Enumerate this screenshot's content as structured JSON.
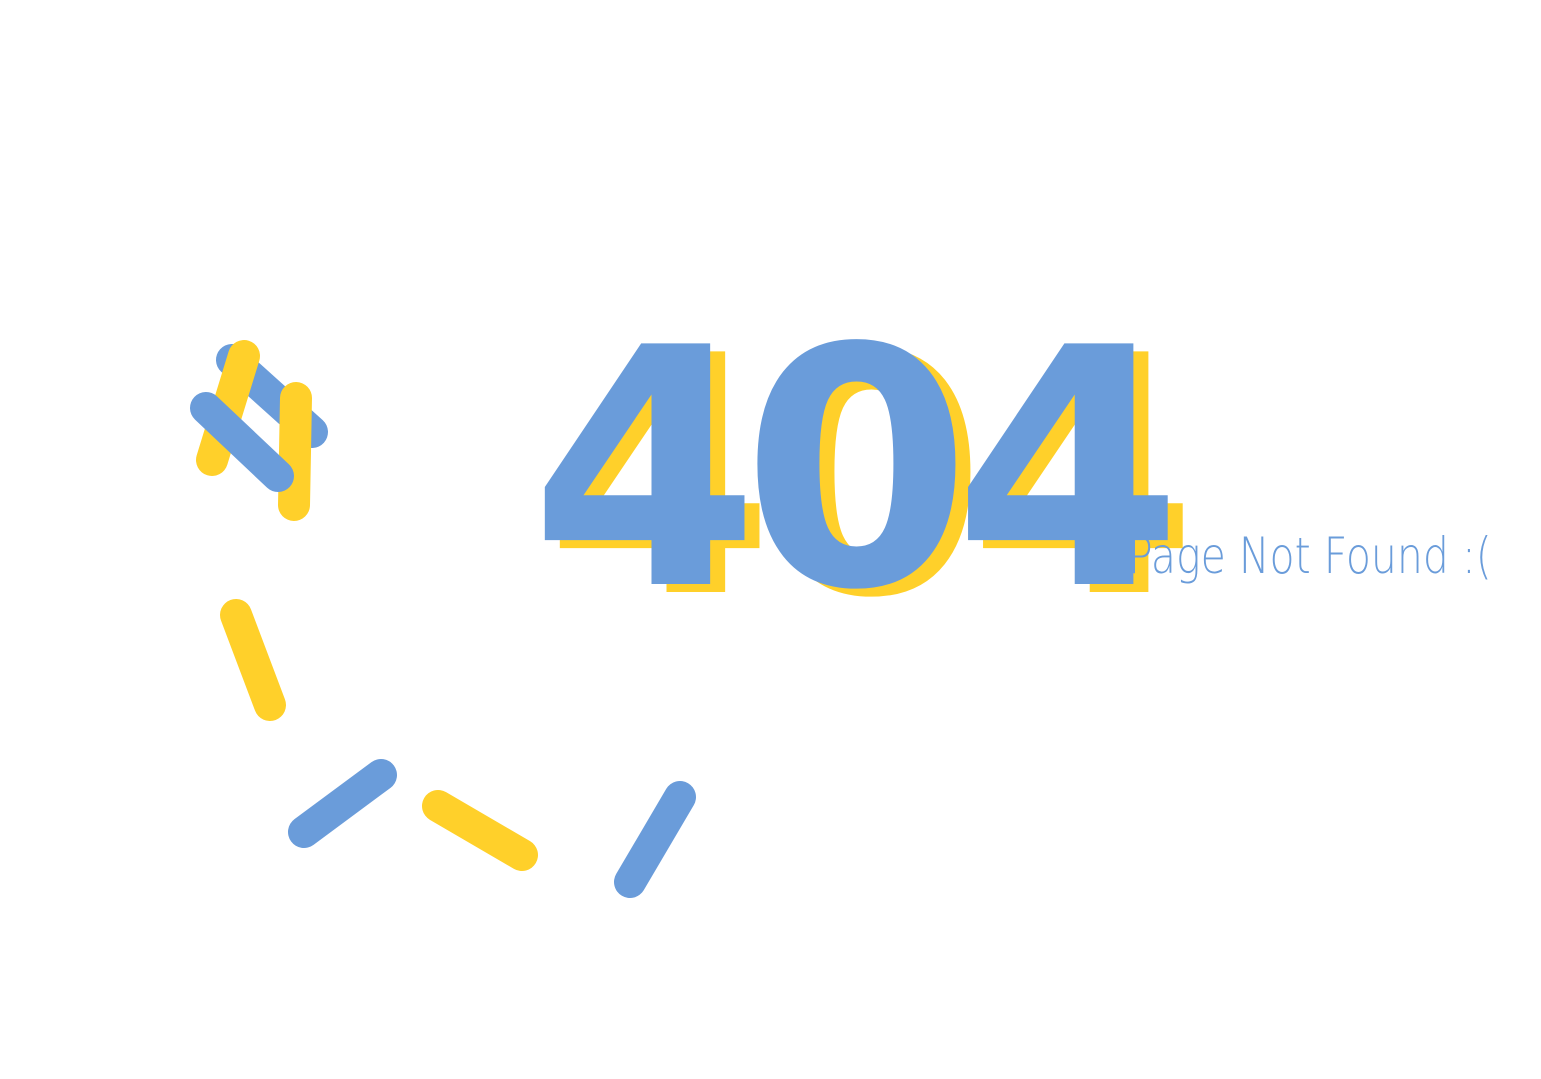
{
  "error": {
    "code": "404",
    "message": "Page Not Found :("
  },
  "colors": {
    "blue": "#6a9cda",
    "yellow": "#ffd02a",
    "background": "#ffffff"
  }
}
